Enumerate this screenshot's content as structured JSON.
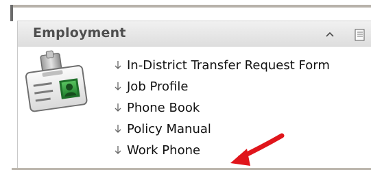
{
  "panel": {
    "title": "Employment"
  },
  "icons": {
    "badge": "id-badge-icon",
    "collapse": "chevron-up-icon",
    "menu": "document-menu-icon",
    "bullet": "down-arrow-bullet-icon",
    "annotation": "red-arrow-icon"
  },
  "links": [
    {
      "label": "In-District Transfer Request Form"
    },
    {
      "label": "Job Profile"
    },
    {
      "label": "Phone Book"
    },
    {
      "label": "Policy Manual"
    },
    {
      "label": "Work Phone"
    }
  ],
  "colors": {
    "header_text": "#4e4e4e",
    "link_text": "#111111",
    "annotation_arrow": "#e0151b",
    "badge_green": "#2f9f3f"
  }
}
